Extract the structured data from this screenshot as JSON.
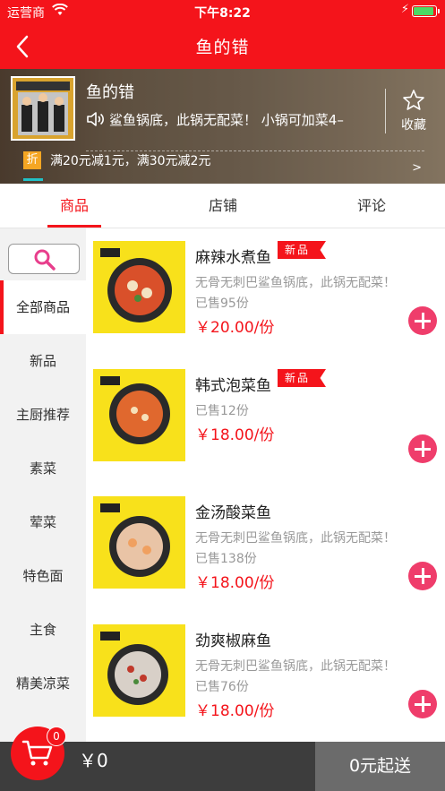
{
  "status_bar": {
    "carrier": "运营商",
    "time": "下午8:22"
  },
  "nav": {
    "title": "鱼的错"
  },
  "shop": {
    "name": "鱼的错",
    "notice": "鲨鱼锅底，此锅无配菜！ 小锅可加菜4–",
    "favorite_label": "收藏",
    "promo_tag": "折",
    "promo_text": "满20元减1元，满30元减2元",
    "promo_arrow": ">"
  },
  "tabs": [
    {
      "label": "商品",
      "active": true
    },
    {
      "label": "店铺",
      "active": false
    },
    {
      "label": "评论",
      "active": false
    }
  ],
  "sidebar": {
    "categories": [
      {
        "label": "全部商品",
        "active": true
      },
      {
        "label": "新品",
        "active": false
      },
      {
        "label": "主厨推荐",
        "active": false
      },
      {
        "label": "素菜",
        "active": false
      },
      {
        "label": "荤菜",
        "active": false
      },
      {
        "label": "特色面",
        "active": false
      },
      {
        "label": "主食",
        "active": false
      },
      {
        "label": "精美凉菜",
        "active": false
      }
    ]
  },
  "products": [
    {
      "name": "麻辣水煮鱼",
      "tag": "新品",
      "desc": "无骨无刺巴鲨鱼锅底，此锅无配菜！",
      "sold": "已售95份",
      "price": "￥20.00/份"
    },
    {
      "name": "韩式泡菜鱼",
      "tag": "新品",
      "desc": "",
      "sold": "已售12份",
      "price": "￥18.00/份"
    },
    {
      "name": "金汤酸菜鱼",
      "tag": "",
      "desc": "无骨无刺巴鲨鱼锅底，此锅无配菜！",
      "sold": "已售138份",
      "price": "￥18.00/份"
    },
    {
      "name": "劲爽椒麻鱼",
      "tag": "",
      "desc": "无骨无刺巴鲨鱼锅底，此锅无配菜！",
      "sold": "已售76份",
      "price": "￥18.00/份"
    }
  ],
  "cart": {
    "badge": "0",
    "total": "￥0",
    "checkout_label": "0元起送"
  },
  "colors": {
    "brand_red": "#f4141b",
    "add_button": "#ef3d6b",
    "thumb_yellow": "#f8e11b",
    "bottom_bar": "#3d3d3d"
  }
}
